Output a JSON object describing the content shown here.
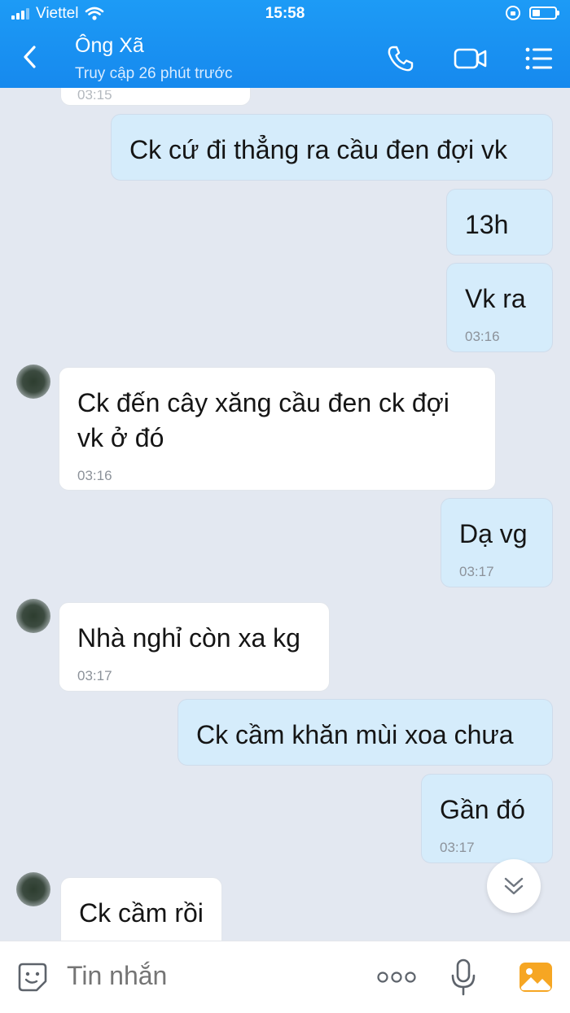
{
  "status_bar": {
    "carrier": "Viettel",
    "time": "15:58"
  },
  "header": {
    "title": "Ông Xã",
    "subtitle": "Truy cập 26 phút trước"
  },
  "icons": {
    "back": "chevron-left-icon",
    "call": "phone-icon",
    "video": "video-camera-icon",
    "menu": "list-menu-icon",
    "sticker": "sticker-smiley-icon",
    "more": "more-dots-icon",
    "mic": "microphone-icon",
    "gallery": "image-gallery-icon",
    "scroll": "scroll-down-icon"
  },
  "colors": {
    "header_blue": "#1a93f2",
    "sent_bubble": "#d5ecfb",
    "received_bubble": "#ffffff",
    "chat_background": "#e3e8f1",
    "gallery_orange": "#f6a623"
  },
  "messages": [
    {
      "direction": "received",
      "text": "",
      "time": "03:15",
      "partial": true
    },
    {
      "direction": "sent",
      "text": "Ck cứ đi thẳng ra cầu đen đợi vk",
      "time": ""
    },
    {
      "direction": "sent",
      "text": "13h",
      "time": ""
    },
    {
      "direction": "sent",
      "text": "Vk ra",
      "time": "03:16"
    },
    {
      "direction": "received",
      "text": "Ck đến cây xăng cầu đen ck đợi vk ở đó",
      "time": "03:16"
    },
    {
      "direction": "sent",
      "text": "Dạ vg",
      "time": "03:17"
    },
    {
      "direction": "received",
      "text": "Nhà nghỉ còn xa kg",
      "time": "03:17"
    },
    {
      "direction": "sent",
      "text": "Ck cầm khăn mùi xoa chưa",
      "time": ""
    },
    {
      "direction": "sent",
      "text": "Gần đó",
      "time": "03:17"
    },
    {
      "direction": "received",
      "text": "Ck cầm rồi",
      "time": ""
    }
  ],
  "composer": {
    "placeholder": "Tin nhắn"
  }
}
